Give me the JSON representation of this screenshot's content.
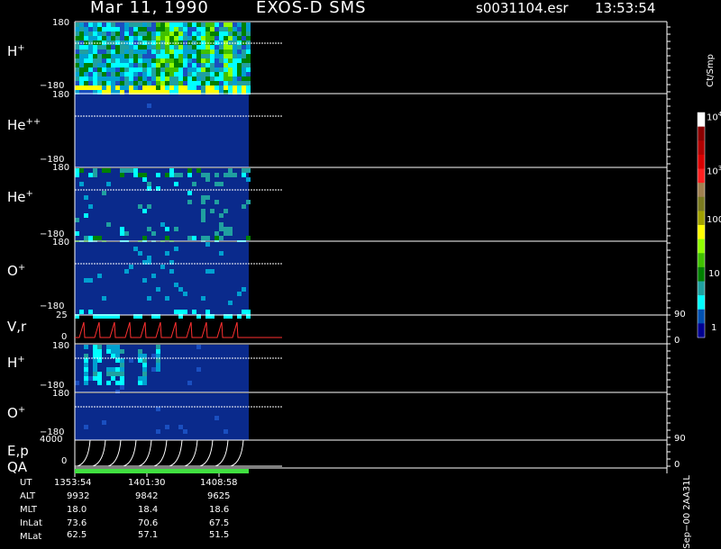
{
  "header": {
    "date": "Mar 11, 1990",
    "mission": "EXOS-D SMS",
    "file": "s0031104.esr",
    "time": "13:53:54"
  },
  "panels": [
    {
      "id": "hplus",
      "label": "H",
      "sup": "+",
      "top": "180",
      "bottom": "−180"
    },
    {
      "id": "heplus2",
      "label": "He",
      "sup": "++",
      "top": "180",
      "bottom": "−180"
    },
    {
      "id": "heplus",
      "label": "He",
      "sup": "+",
      "top": "180",
      "bottom": "−180"
    },
    {
      "id": "oplus",
      "label": "O",
      "sup": "+",
      "top": "180",
      "bottom": "−180"
    },
    {
      "id": "vr",
      "label": "V,r",
      "sup": "",
      "top": "25",
      "bottom": "0",
      "right_top": "90",
      "right_bottom": "0"
    },
    {
      "id": "hplus2",
      "label": "H",
      "sup": "+",
      "top": "180",
      "bottom": "−180"
    },
    {
      "id": "oplus2",
      "label": "O",
      "sup": "+",
      "top": "180",
      "bottom": "−180"
    },
    {
      "id": "ep",
      "label": "E,p",
      "sup": "",
      "top": "4000",
      "bottom": "0",
      "right_top": "90",
      "right_bottom": "0"
    }
  ],
  "qa_label": "QA",
  "colorbar": {
    "unit": "Ct/Smp",
    "labels": [
      "10",
      "10",
      "100",
      "10",
      "1"
    ],
    "sups": [
      "4",
      "3",
      "",
      "",
      ""
    ],
    "colors": [
      "#ffffff",
      "#8b0000",
      "#b00000",
      "#d80000",
      "#ff2020",
      "#a08050",
      "#7a7a20",
      "#a0a000",
      "#ffff00",
      "#90ff00",
      "#40c000",
      "#008000",
      "#20a0a0",
      "#00ffff",
      "#0050b0",
      "#000090"
    ]
  },
  "ephemeris": {
    "rows": [
      {
        "name": "UT",
        "values": [
          "1353:54",
          "1401:30",
          "1408:58"
        ]
      },
      {
        "name": "ALT",
        "values": [
          "9932",
          "9842",
          "9625"
        ]
      },
      {
        "name": "MLT",
        "values": [
          "18.0",
          "18.4",
          "18.6"
        ]
      },
      {
        "name": "InLat",
        "values": [
          "73.6",
          "70.6",
          "67.5"
        ]
      },
      {
        "name": "MLat",
        "values": [
          "62.5",
          "57.1",
          "51.5"
        ]
      }
    ]
  },
  "footer_tag": "Sep−00 2AA31L",
  "chart_data": {
    "type": "heatmap",
    "title": "Mar 11, 1990   EXOS-D SMS",
    "x_tick_labels": [
      "1353:54",
      "1401:30",
      "1408:58"
    ],
    "pitch_angle_range": [
      -180,
      180
    ],
    "velocity_range": [
      0,
      25
    ],
    "energy_range": [
      0,
      4000
    ],
    "colorbar_unit": "Ct/Smp",
    "colorbar_scale": "log",
    "colorbar_range": [
      1,
      10000
    ],
    "grid": false,
    "legend_position": "right"
  }
}
